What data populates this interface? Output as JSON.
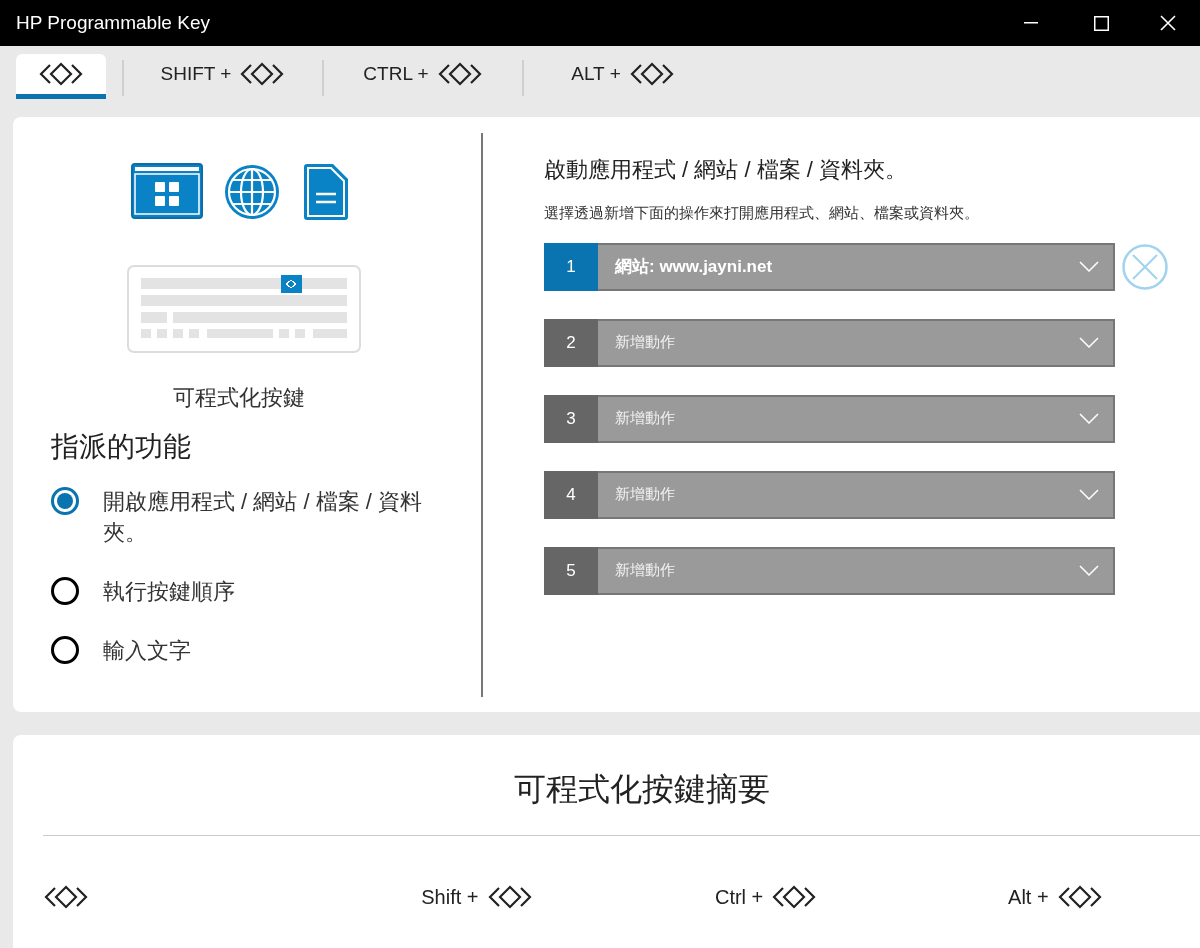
{
  "window": {
    "title": "HP Programmable Key"
  },
  "tabs": [
    {
      "selected": true
    },
    {
      "label": "SHIFT +",
      "selected": false
    },
    {
      "label": "CTRL +",
      "selected": false
    },
    {
      "label": "ALT +",
      "selected": false
    }
  ],
  "left_panel": {
    "key_caption": "可程式化按鍵",
    "heading": "指派的功能",
    "options": [
      {
        "label": "開啟應用程式 / 網站 / 檔案 / 資料夾。",
        "selected": true
      },
      {
        "label": "執行按鍵順序",
        "selected": false
      },
      {
        "label": "輸入文字",
        "selected": false
      }
    ]
  },
  "right_panel": {
    "title": "啟動應用程式 / 網站 / 檔案 / 資料夾。",
    "subtitle": "選擇透過新增下面的操作來打開應用程式、網站、檔案或資料夾。",
    "actions": [
      {
        "number": "1",
        "value": "網站: www.jayni.net",
        "selected": true
      },
      {
        "number": "2",
        "placeholder": "新增動作",
        "selected": false
      },
      {
        "number": "3",
        "placeholder": "新增動作",
        "selected": false
      },
      {
        "number": "4",
        "placeholder": "新增動作",
        "selected": false
      },
      {
        "number": "5",
        "placeholder": "新增動作",
        "selected": false
      }
    ]
  },
  "summary": {
    "title": "可程式化按鍵摘要",
    "columns": [
      {},
      {
        "label": "Shift +"
      },
      {
        "label": "Ctrl +"
      },
      {
        "label": "Alt +"
      }
    ]
  }
}
